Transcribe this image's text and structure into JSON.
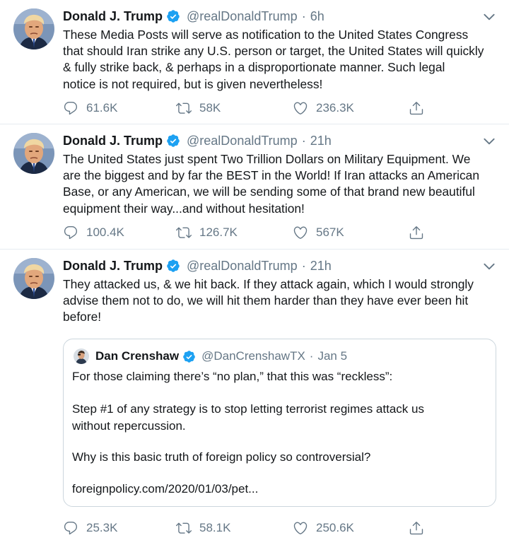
{
  "tweets": [
    {
      "name": "Donald J. Trump",
      "handle": "@realDonaldTrump",
      "dot": "·",
      "time": "6h",
      "lines": [
        "These Media Posts will serve as notification to the United States Congress",
        "that should Iran strike any U.S. person or target, the United States will quickly",
        "& fully strike back, & perhaps in a disproportionate manner. Such legal",
        "notice is not required, but is given nevertheless!"
      ],
      "replies": "61.6K",
      "retweets": "58K",
      "likes": "236.3K"
    },
    {
      "name": "Donald J. Trump",
      "handle": "@realDonaldTrump",
      "dot": "·",
      "time": "21h",
      "lines": [
        "The United States just spent Two Trillion Dollars on Military Equipment. We",
        "are the biggest and by far the BEST in the World! If Iran attacks an American",
        "Base, or any American, we will be sending some of that brand new beautiful",
        "equipment their way...and without hesitation!"
      ],
      "replies": "100.4K",
      "retweets": "126.7K",
      "likes": "567K"
    },
    {
      "name": "Donald J. Trump",
      "handle": "@realDonaldTrump",
      "dot": "·",
      "time": "21h",
      "lines": [
        "They attacked us, & we hit back. If they attack again, which I would strongly",
        "advise them not to do, we will hit them harder than they have ever been hit",
        "before!"
      ],
      "quoted": {
        "name": "Dan Crenshaw",
        "handle": "@DanCrenshawTX",
        "dot": "·",
        "time": "Jan 5",
        "lines": [
          "For those claiming there’s “no plan,” that this was “reckless”:",
          "Step #1 of any strategy is to stop letting terrorist regimes attack us",
          "without repercussion.",
          "Why is this basic truth of foreign policy so controversial?",
          "foreignpolicy.com/2020/01/03/pet..."
        ]
      },
      "replies": "25.3K",
      "retweets": "58.1K",
      "likes": "250.6K"
    }
  ],
  "icons": {
    "verified": "verified-badge-icon",
    "more": "chevron-down-icon",
    "reply": "reply-icon",
    "retweet": "retweet-icon",
    "like": "heart-icon",
    "share": "share-icon"
  },
  "colors": {
    "accent": "#1da1f2",
    "text": "#14171a",
    "secondary": "#657786",
    "border": "#e6ecf0",
    "quote_border": "#ccd6dd"
  }
}
